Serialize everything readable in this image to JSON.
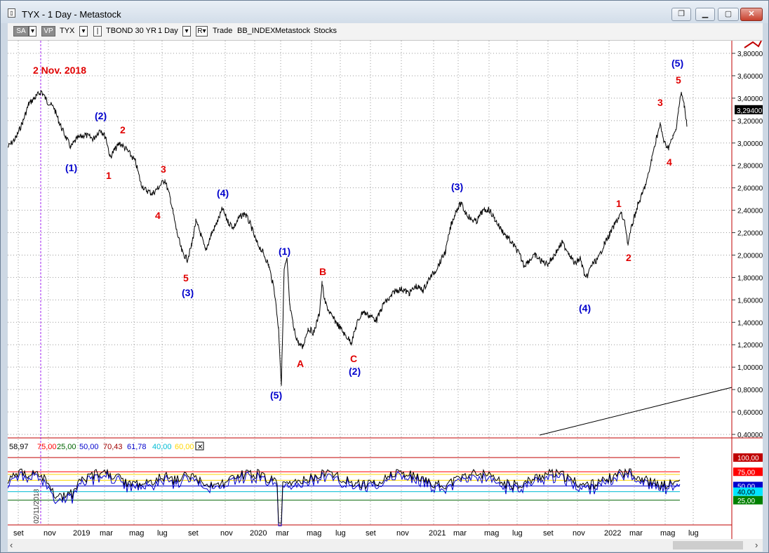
{
  "window": {
    "title": "TYX - 1 Day - Metastock",
    "buttons": {
      "restore_icon": "restore-icon",
      "minimize_icon": "minimize-icon",
      "maximize_icon": "maximize-icon",
      "close_icon": "close-icon"
    }
  },
  "toolbar": {
    "sa_label": "SA",
    "vp_label": "VP",
    "symbol": "TYX",
    "security_name": "TBOND 30 YR",
    "timeframe": "1 Day",
    "r_label": "R",
    "trade": "Trade",
    "source": "BB_INDEX",
    "data_vendor": "Metastock",
    "type": "Stocks"
  },
  "chart_data": [
    {
      "type": "line",
      "title": "",
      "series": [
        {
          "name": "",
          "x": [
            "2018-09",
            "2018-10",
            "2018-11",
            "2018-12",
            "2019-01",
            "2019-02",
            "2019-03",
            "2019-04",
            "2019-05",
            "2019-06",
            "2019-07",
            "2019-08",
            "2019-09",
            "2019-10",
            "2019-11",
            "2019-12",
            "2020-01",
            "2020-02",
            "2020-03",
            "2020-04",
            "2020-05",
            "2020-06",
            "2020-07",
            "2020-08",
            "2020-09",
            "2020-10",
            "2020-11",
            "2020-12",
            "2021-01",
            "2021-02",
            "2021-03",
            "2021-04",
            "2021-05",
            "2021-06",
            "2021-07",
            "2021-08",
            "2021-09",
            "2021-10",
            "2021-11",
            "2021-12",
            "2022-01",
            "2022-02",
            "2022-03",
            "2022-04",
            "2022-05",
            "2022-06"
          ],
          "values": [
            3.05,
            3.35,
            3.4,
            3.1,
            2.95,
            3.05,
            2.95,
            2.85,
            2.6,
            2.55,
            2.55,
            2.0,
            2.1,
            2.3,
            2.4,
            2.3,
            2.3,
            2.0,
            1.1,
            1.35,
            1.4,
            1.45,
            1.3,
            1.45,
            1.45,
            1.55,
            1.65,
            1.65,
            1.7,
            1.95,
            2.35,
            2.35,
            2.25,
            2.2,
            2.1,
            1.9,
            1.9,
            2.05,
            1.95,
            1.85,
            2.0,
            2.2,
            2.45,
            2.9,
            3.05,
            3.29
          ]
        }
      ],
      "ylim": [
        0.4,
        3.9
      ],
      "y_ticks": [
        "3,80000",
        "3,60000",
        "3,40000",
        "3,20000",
        "3,00000",
        "2,80000",
        "2,60000",
        "2,40000",
        "2,20000",
        "2,00000",
        "1,80000",
        "1,60000",
        "1,40000",
        "1,20000",
        "1,00000",
        "0,80000",
        "0,60000",
        "0,40000"
      ],
      "last_value": "3,29400",
      "annotations": {
        "date_note": "2 Nov. 2018",
        "blue": [
          "(1)",
          "(2)",
          "(3)",
          "(4)",
          "(5)",
          "(1)",
          "(2)",
          "(3)",
          "(4)",
          "(5)"
        ],
        "red": [
          "1",
          "2",
          "3",
          "4",
          "5",
          "A",
          "B",
          "C",
          "1",
          "2",
          "3",
          "4",
          "5"
        ]
      }
    },
    {
      "type": "line",
      "title": "",
      "series": [
        {
          "name": "",
          "values": [
            58.97,
            61.78,
            70.43
          ]
        }
      ],
      "ylim": [
        0,
        100
      ],
      "y_ticks": [
        "100,00",
        "75,00",
        "50,00",
        "40,00",
        "25,00"
      ],
      "indicator_values": [
        "58,97",
        "75,00",
        "25,00",
        "50,00",
        "70,43",
        "61,78",
        "40,00",
        "60,00"
      ],
      "indicator_colors": [
        "#000000",
        "#ff0000",
        "#006400",
        "#0000cc",
        "#a00000",
        "#0000cc",
        "#00bcd4",
        "#ffd700"
      ]
    }
  ],
  "x_axis": {
    "ticks": [
      "set",
      "nov",
      "2019",
      "mar",
      "mag",
      "lug",
      "set",
      "nov",
      "2020",
      "mar",
      "mag",
      "lug",
      "set",
      "nov",
      "2021",
      "mar",
      "mag",
      "lug",
      "set",
      "nov",
      "2022",
      "mar",
      "mag",
      "lug"
    ],
    "vertical_date": "02/11/2018"
  }
}
